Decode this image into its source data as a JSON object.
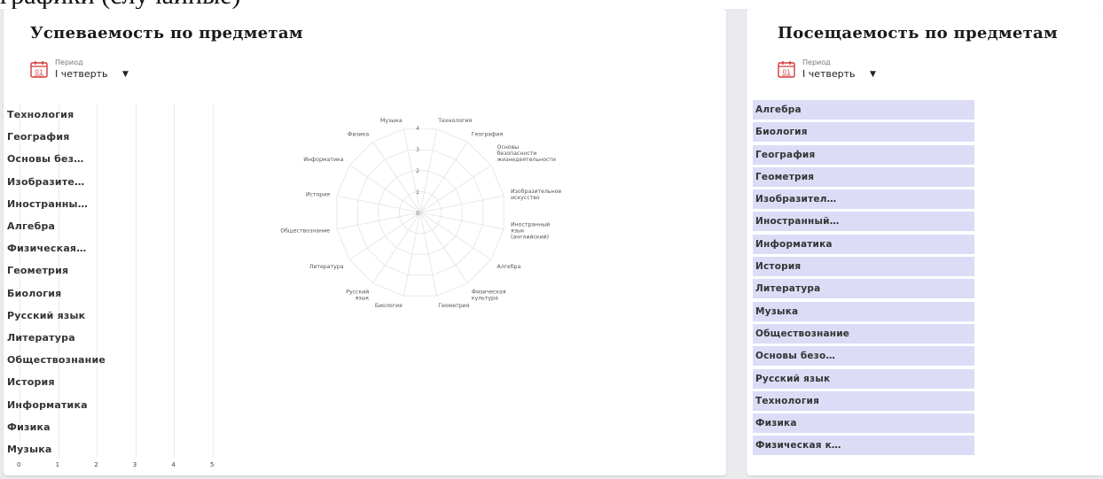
{
  "colors": {
    "accent_red": "#d33a3a",
    "attendance_bar": "#dcdcf7",
    "grid": "#e6e6e6"
  },
  "left_panel": {
    "title": "Успеваемость по предметам",
    "period": {
      "icon": "calendar-icon",
      "icon_text": "01",
      "caption": "Период",
      "value": "I четверть"
    },
    "bar_chart": {
      "categories": [
        "Технология",
        "География",
        "Основы без…",
        "Изобразите…",
        "Иностранны…",
        "Алгебра",
        "Физическая…",
        "Геометрия",
        "Биология",
        "Русский язык",
        "Литература",
        "Обществознание",
        "История",
        "Информатика",
        "Физика",
        "Музыка"
      ],
      "x_ticks": [
        "0",
        "1",
        "2",
        "3",
        "4",
        "5"
      ]
    }
  },
  "right_panel": {
    "title": "Посещаемость по предметам",
    "period": {
      "icon": "calendar-icon",
      "icon_text": "01",
      "caption": "Период",
      "value": "I четверть"
    },
    "subjects": [
      "Алгебра",
      "Биология",
      "География",
      "Геометрия",
      "Изобразител…",
      "Иностранный…",
      "Информатика",
      "История",
      "Литература",
      "Музыка",
      "Обществознание",
      "Основы безо…",
      "Русский язык",
      "Технология",
      "Физика",
      "Физическая к…"
    ]
  },
  "chart_data": [
    {
      "type": "bar",
      "orientation": "horizontal",
      "categories": [
        "Технология",
        "География",
        "Основы без…",
        "Изобразите…",
        "Иностранны…",
        "Алгебра",
        "Физическая…",
        "Геометрия",
        "Биология",
        "Русский язык",
        "Литература",
        "Обществознание",
        "История",
        "Информатика",
        "Физика",
        "Музыка"
      ],
      "values": [
        0,
        0,
        0,
        0,
        0,
        0,
        0,
        0,
        0,
        0,
        0,
        0,
        0,
        0,
        0,
        0
      ],
      "xlim": [
        0,
        5
      ],
      "x_ticks": [
        "0",
        "1",
        "2",
        "3",
        "4",
        "5"
      ],
      "grid": true
    },
    {
      "type": "radar",
      "categories": [
        [
          "Музыка"
        ],
        [
          "Технология"
        ],
        [
          "География"
        ],
        [
          "Основы",
          "безопасности",
          "жизнедеятельности"
        ],
        [
          "Изобразительное",
          "искусство"
        ],
        [
          "Иностранный",
          "язык",
          "(английский)"
        ],
        [
          "Алгебра"
        ],
        [
          "Физическая",
          "культура"
        ],
        [
          "Геометрия"
        ],
        [
          "Биология"
        ],
        [
          "Русский",
          "язык"
        ],
        [
          "Литература"
        ],
        [
          "Обществознание"
        ],
        [
          "История"
        ],
        [
          "Информатика"
        ],
        [
          "Физика"
        ]
      ],
      "values": [
        0,
        0,
        0,
        0,
        0,
        0,
        0,
        0,
        0,
        0,
        0,
        0,
        0,
        0,
        0,
        0
      ],
      "rlim": [
        0,
        4
      ],
      "r_ticks": [
        "0",
        "1",
        "2",
        "3",
        "4"
      ],
      "grid": true
    }
  ]
}
